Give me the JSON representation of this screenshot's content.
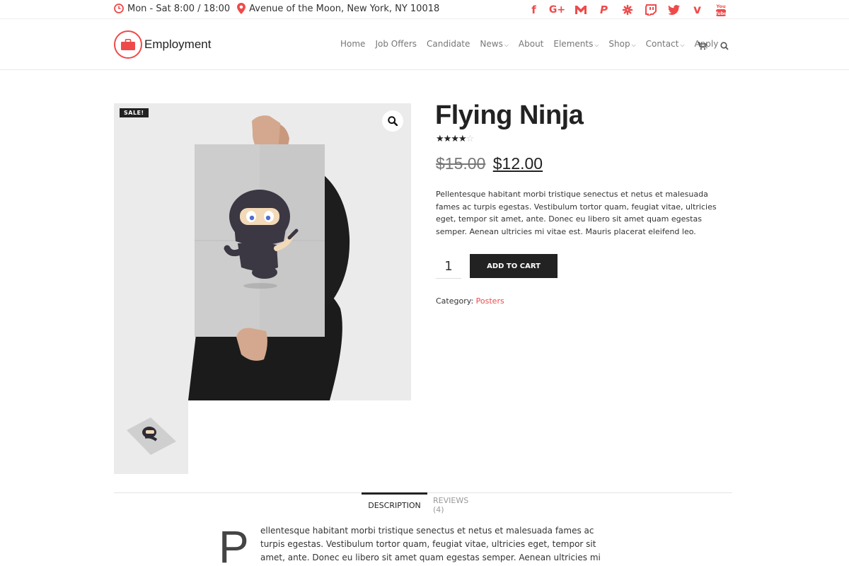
{
  "topbar": {
    "hours": "Mon - Sat 8:00 / 18:00",
    "address": "Avenue of the Moon, New York, NY 10018",
    "social": [
      "facebook-icon",
      "google-plus-icon",
      "gmail-icon",
      "paypal-icon",
      "yelp-icon",
      "twitch-icon",
      "twitter-icon",
      "vimeo-icon",
      "youtube-icon"
    ]
  },
  "header": {
    "logo_text": "Employment",
    "nav": [
      {
        "label": "Home"
      },
      {
        "label": "Job Offers"
      },
      {
        "label": "Candidate"
      },
      {
        "label": "News"
      },
      {
        "label": "About"
      },
      {
        "label": "Elements"
      },
      {
        "label": "Shop"
      },
      {
        "label": "Contact"
      },
      {
        "label": "Apply"
      }
    ],
    "cart_icon": "cart-icon",
    "search_icon": "search-icon"
  },
  "product": {
    "sale_badge": "SALE!",
    "title": "Flying Ninja",
    "rating": 4,
    "rating_max": 5,
    "old_price": "$15.00",
    "new_price": "$12.00",
    "description": "Pellentesque habitant morbi tristique senectus et netus et malesuada fames ac turpis egestas. Vestibulum tortor quam, feugiat vitae, ultricies eget, tempor sit amet, ante. Donec eu libero sit amet quam egestas semper. Aenean ultricies mi vitae est. Mauris placerat eleifend leo.",
    "quantity": "1",
    "add_to_cart": "ADD TO CART",
    "category_label": "Category:",
    "category_value": "Posters"
  },
  "tabs": {
    "description": "DESCRIPTION",
    "reviews": "REVIEWS (4)"
  },
  "tab_content": {
    "dropcap": "P",
    "text": "ellentesque habitant morbi tristique senectus et netus et malesuada fames ac turpis egestas. Vestibulum tortor quam, feugiat vitae, ultricies eget, tempor sit amet, ante. Donec eu libero sit amet quam egestas semper. Aenean ultricies mi vitae est. Mauris"
  },
  "colors": {
    "accent": "#ef4a4a",
    "dark": "#222222"
  }
}
